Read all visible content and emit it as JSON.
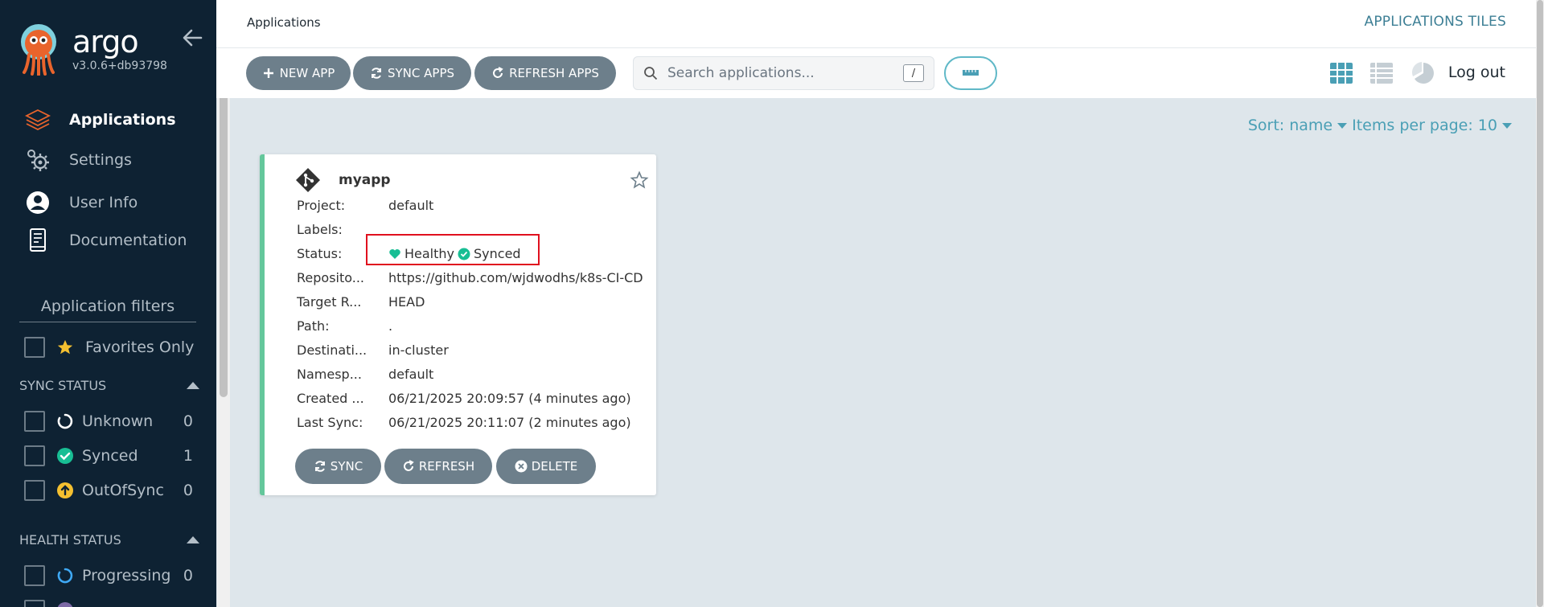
{
  "brand": {
    "name": "argo",
    "version": "v3.0.6+db93798"
  },
  "nav": [
    {
      "label": "Applications",
      "icon": "layers-icon",
      "active": true
    },
    {
      "label": "Settings",
      "icon": "gears-icon",
      "active": false
    },
    {
      "label": "User Info",
      "icon": "user-circle-icon",
      "active": false
    },
    {
      "label": "Documentation",
      "icon": "book-icon",
      "active": false
    }
  ],
  "filters": {
    "title": "Application filters",
    "favorites_label": "Favorites Only",
    "sync_status": {
      "title": "SYNC STATUS",
      "items": [
        {
          "label": "Unknown",
          "count": "0"
        },
        {
          "label": "Synced",
          "count": "1"
        },
        {
          "label": "OutOfSync",
          "count": "0"
        }
      ]
    },
    "health_status": {
      "title": "HEALTH STATUS",
      "items": [
        {
          "label": "Progressing",
          "count": "0"
        }
      ]
    }
  },
  "topbar": {
    "breadcrumb": "Applications",
    "title": "APPLICATIONS TILES"
  },
  "toolbar": {
    "new_app": "NEW APP",
    "sync_apps": "SYNC APPS",
    "refresh_apps": "REFRESH APPS",
    "search_placeholder": "Search applications...",
    "search_shortcut": "/",
    "logout": "Log out"
  },
  "sort": {
    "label": "Sort: name",
    "per_page": "Items per page: 10"
  },
  "app": {
    "name": "myapp",
    "fields": [
      {
        "k": "Project:",
        "v": "default"
      },
      {
        "k": "Labels:",
        "v": ""
      },
      {
        "k": "Status:",
        "v": ""
      },
      {
        "k": "Reposito...",
        "v": "https://github.com/wjdwodhs/k8s-CI-CD"
      },
      {
        "k": "Target R...",
        "v": "HEAD"
      },
      {
        "k": "Path:",
        "v": "."
      },
      {
        "k": "Destinati...",
        "v": "in-cluster"
      },
      {
        "k": "Namesp...",
        "v": "default"
      },
      {
        "k": "Created ...",
        "v": "06/21/2025 20:09:57  (4 minutes ago)"
      },
      {
        "k": "Last Sync:",
        "v": "06/21/2025 20:11:07  (2 minutes ago)"
      }
    ],
    "health": "Healthy",
    "sync": "Synced",
    "buttons": {
      "sync": "SYNC",
      "refresh": "REFRESH",
      "delete": "DELETE"
    }
  },
  "colors": {
    "sidebar_bg": "#0e2233",
    "accent": "#4a9fb5",
    "healthy": "#18be94",
    "button_bg": "#6d7f8b",
    "highlight_box": "#e0101e",
    "card_border": "#64c79b"
  }
}
